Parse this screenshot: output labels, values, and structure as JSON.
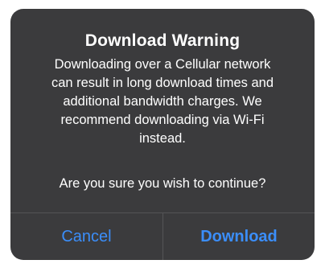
{
  "dialog": {
    "title": "Download Warning",
    "message_lines": [
      "Downloading over a Cellular network",
      "can result in long download times and",
      "additional bandwidth charges. We",
      "recommend downloading via Wi-Fi",
      "instead."
    ],
    "question": "Are you sure you wish to continue?",
    "buttons": {
      "cancel": "Cancel",
      "download": "Download"
    }
  },
  "colors": {
    "dialog_background": "#3b3b3d",
    "text": "#ffffff",
    "button_text": "#3b8efa",
    "divider": "#545456"
  }
}
